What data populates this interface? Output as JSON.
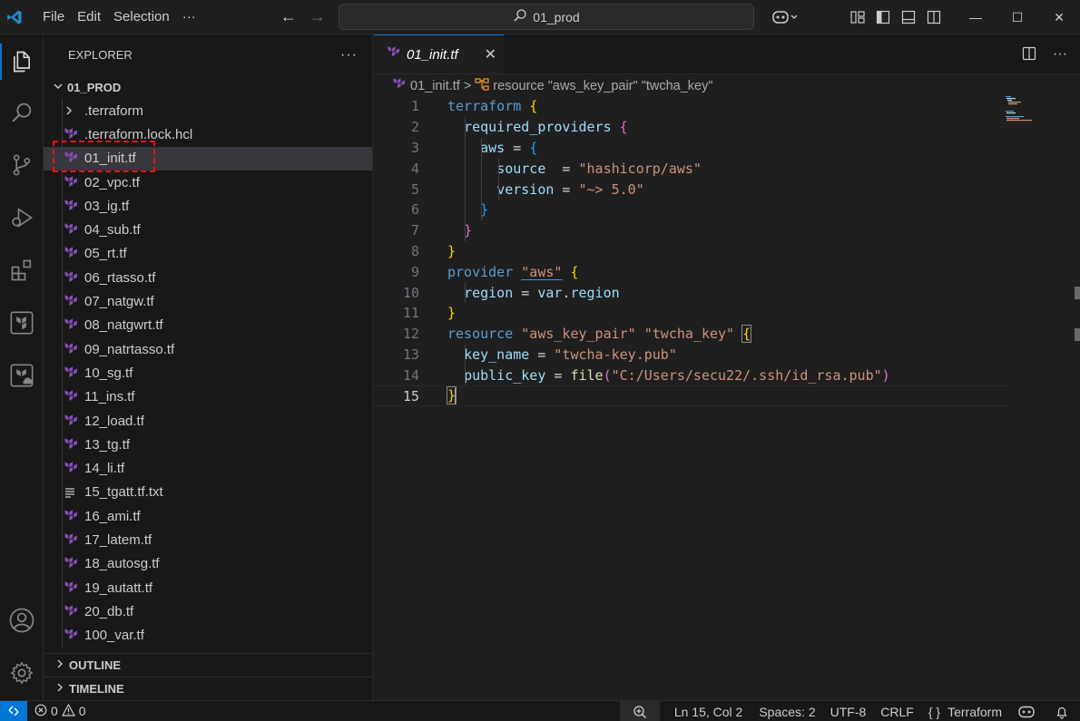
{
  "titlebar": {
    "menu": [
      "File",
      "Edit",
      "Selection",
      "···"
    ],
    "search_text": "01_prod",
    "icons": [
      "vscode-logo-icon",
      "back-arrow-icon",
      "forward-arrow-icon",
      "search-icon",
      "copilot-icon",
      "customize-layout-icon",
      "toggle-sidebar-icon",
      "toggle-panel-icon",
      "toggle-secondary-sidebar-icon"
    ],
    "window_controls": [
      "—",
      "☐",
      "✕"
    ]
  },
  "activity_bar": [
    "explorer-icon",
    "search-icon",
    "source-control-icon",
    "run-debug-icon",
    "extensions-icon",
    "terraform-icon",
    "terraform-cloud-icon",
    "accounts-icon",
    "settings-gear-icon"
  ],
  "sidebar": {
    "title": "EXPLORER",
    "more": "···",
    "root_folder": "01_PROD",
    "items": [
      {
        "name": ".terraform",
        "type": "folder"
      },
      {
        "name": ".terraform.lock.hcl",
        "type": "tf"
      },
      {
        "name": "01_init.tf",
        "type": "tf",
        "selected": true
      },
      {
        "name": "02_vpc.tf",
        "type": "tf"
      },
      {
        "name": "03_ig.tf",
        "type": "tf"
      },
      {
        "name": "04_sub.tf",
        "type": "tf"
      },
      {
        "name": "05_rt.tf",
        "type": "tf"
      },
      {
        "name": "06_rtasso.tf",
        "type": "tf"
      },
      {
        "name": "07_natgw.tf",
        "type": "tf"
      },
      {
        "name": "08_natgwrt.tf",
        "type": "tf"
      },
      {
        "name": "09_natrtasso.tf",
        "type": "tf"
      },
      {
        "name": "10_sg.tf",
        "type": "tf"
      },
      {
        "name": "11_ins.tf",
        "type": "tf"
      },
      {
        "name": "12_load.tf",
        "type": "tf"
      },
      {
        "name": "13_tg.tf",
        "type": "tf"
      },
      {
        "name": "14_li.tf",
        "type": "tf"
      },
      {
        "name": "15_tgatt.tf.txt",
        "type": "txt"
      },
      {
        "name": "16_ami.tf",
        "type": "tf"
      },
      {
        "name": "17_latem.tf",
        "type": "tf"
      },
      {
        "name": "18_autosg.tf",
        "type": "tf"
      },
      {
        "name": "19_autatt.tf",
        "type": "tf"
      },
      {
        "name": "20_db.tf",
        "type": "tf"
      },
      {
        "name": "100_var.tf",
        "type": "tf"
      }
    ],
    "outline": "OUTLINE",
    "timeline": "TIMELINE"
  },
  "editor": {
    "tab_label": "01_init.tf",
    "tab_close": "✕",
    "breadcrumb_file": "01_init.tf",
    "breadcrumb_sep": ">",
    "breadcrumb_symbol": "resource \"aws_key_pair\" \"twcha_key\"",
    "line_numbers": [
      "1",
      "2",
      "3",
      "4",
      "5",
      "6",
      "7",
      "8",
      "9",
      "10",
      "11",
      "12",
      "13",
      "14",
      "15"
    ],
    "current_line": 15,
    "code_lines": [
      "terraform {",
      "  required_providers {",
      "    aws = {",
      "      source  = \"hashicorp/aws\"",
      "      version = \"~> 5.0\"",
      "    }",
      "  }",
      "}",
      "provider \"aws\" {",
      "  region = var.region",
      "}",
      "resource \"aws_key_pair\" \"twcha_key\" {",
      "  key_name = \"twcha-key.pub\"",
      "  public_key = file(\"C:/Users/secu22/.ssh/id_rsa.pub\")",
      "}"
    ]
  },
  "statusbar": {
    "errors": "0",
    "warnings": "0",
    "position": "Ln 15, Col 2",
    "spaces": "Spaces: 2",
    "encoding": "UTF-8",
    "eol": "CRLF",
    "language": "Terraform",
    "language_icon": "{ }"
  },
  "colors": {
    "accent": "#0078d4",
    "terraform_purple": "#844fba",
    "highlight_box": "#e01515"
  }
}
